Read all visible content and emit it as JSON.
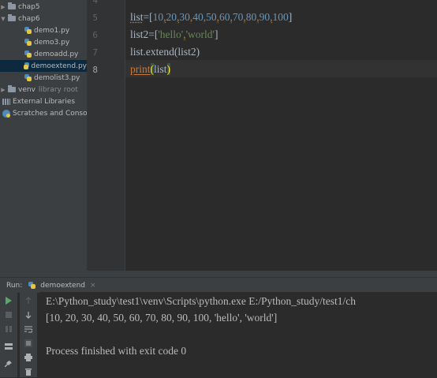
{
  "project_tree": {
    "items": [
      {
        "label": "chap5",
        "type": "folder",
        "expanded": false
      },
      {
        "label": "chap6",
        "type": "folder",
        "expanded": true
      },
      {
        "label": "demo1.py",
        "type": "python-file"
      },
      {
        "label": "demo3.py",
        "type": "python-file"
      },
      {
        "label": "demoadd.py",
        "type": "python-file"
      },
      {
        "label": "demoextend.py",
        "type": "python-file",
        "selected": true
      },
      {
        "label": "demolist3.py",
        "type": "python-file"
      },
      {
        "label": "venv",
        "type": "folder",
        "expanded": false,
        "suffix": "library root"
      },
      {
        "label": "External Libraries",
        "type": "library"
      },
      {
        "label": "Scratches and Consoles",
        "type": "scratch"
      }
    ]
  },
  "editor": {
    "line_numbers": [
      "4",
      "5",
      "6",
      "7",
      "8"
    ],
    "current_line": "8",
    "code": {
      "line5": {
        "var": "list",
        "eq": "=",
        "open": "[",
        "numbers": [
          "10",
          "20",
          "30",
          "40",
          "50",
          "60",
          "70",
          "80",
          "90",
          "100"
        ],
        "sep": ",",
        "close": "]"
      },
      "line6": {
        "prefix": "list2=[",
        "str1": "'hello'",
        "sep": ",",
        "str2": "'world'",
        "suffix": "]"
      },
      "line7": {
        "text": "list.extend(list2)"
      },
      "line8": {
        "func": "print",
        "open": "(",
        "arg": "list",
        "close": ")"
      }
    }
  },
  "run_panel": {
    "label": "Run:",
    "tab_name": "demoextend",
    "close_glyph": "×",
    "output": [
      "E:\\Python_study\\test1\\venv\\Scripts\\python.exe E:/Python_study/test1/ch",
      "[10, 20, 30, 40, 50, 60, 70, 80, 90, 100, 'hello', 'world']",
      "",
      "Process finished with exit code 0"
    ]
  },
  "colors": {
    "keyword": "#cc7832",
    "number": "#6897bb",
    "string": "#6a8759",
    "run_green": "#59a869"
  }
}
